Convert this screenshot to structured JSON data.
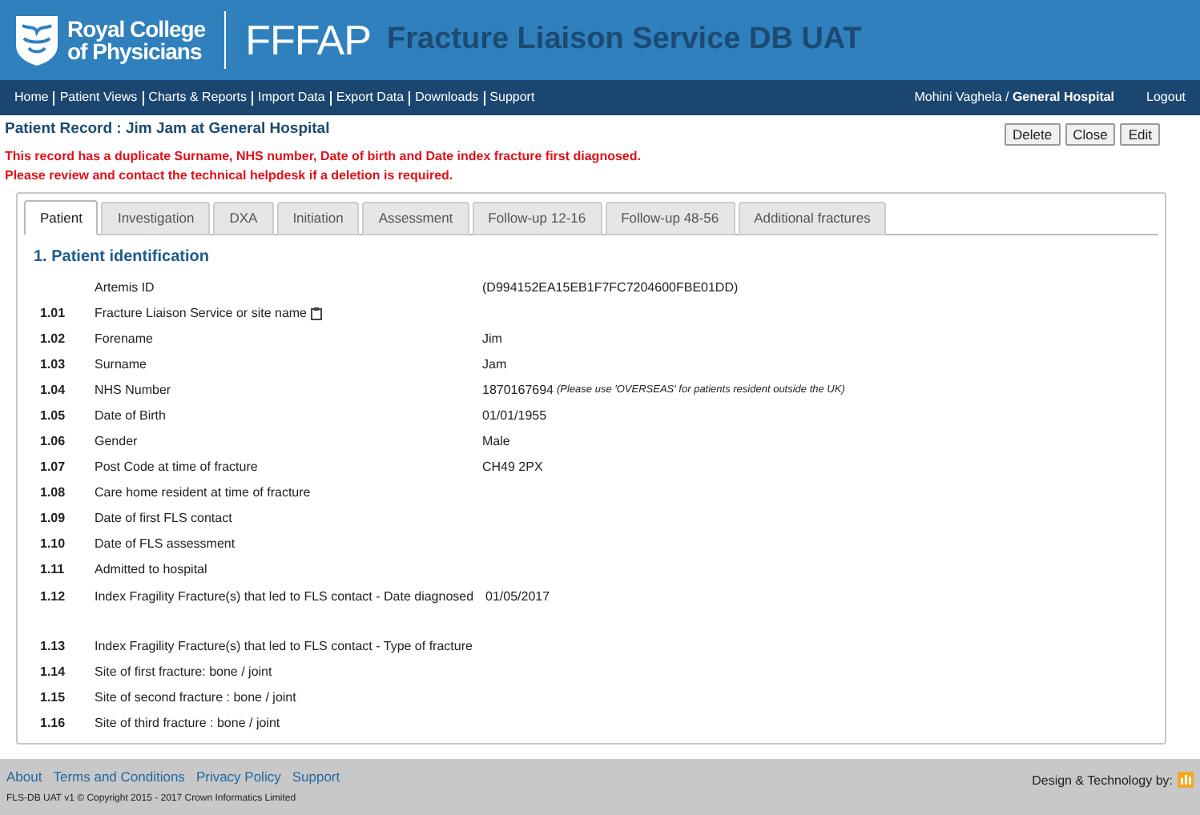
{
  "header": {
    "org_line_1": "Royal College",
    "org_line_2": "of Physicians",
    "program": "FFFAP",
    "app_title": "Fracture Liaison Service DB UAT"
  },
  "nav": {
    "items": [
      "Home",
      "Patient Views",
      "Charts & Reports",
      "Import Data",
      "Export Data",
      "Downloads",
      "Support"
    ],
    "user": "Mohini Vaghela / ",
    "hospital": "General Hospital",
    "logout": "Logout"
  },
  "page_title": "Patient Record : Jim Jam at General Hospital",
  "actions": [
    "Delete",
    "Close",
    "Edit"
  ],
  "warnings": [
    "This record has a duplicate Surname, NHS number, Date of birth and Date index fracture first diagnosed.",
    "Please review and contact the technical helpdesk if a deletion is required."
  ],
  "tabs": [
    {
      "label": "Patient",
      "selected": true
    },
    {
      "label": "Investigation",
      "selected": false
    },
    {
      "label": "DXA",
      "selected": false
    },
    {
      "label": "Initiation",
      "selected": false
    },
    {
      "label": "Assessment",
      "selected": false
    },
    {
      "label": "Follow-up 12-16",
      "selected": false
    },
    {
      "label": "Follow-up 48-56",
      "selected": false
    },
    {
      "label": "Additional fractures",
      "selected": false
    }
  ],
  "section_title": "1. Patient identification",
  "fields": [
    {
      "label": "Artemis ID",
      "value": "(D994152EA15EB1F7FC7204600FBE01DD)"
    },
    {
      "number": "1.01",
      "label": "Fracture Liaison Service or site name",
      "kind": "info"
    },
    {
      "number": "1.02",
      "label": "Forename",
      "value": "Jim"
    },
    {
      "number": "1.03",
      "label": "Surname",
      "value": "Jam"
    },
    {
      "number": "1.04",
      "label": "NHS Number",
      "value": "1870167694",
      "note": "(Please use 'OVERSEAS' for patients resident outside the UK)"
    },
    {
      "number": "1.05",
      "label": "Date of Birth",
      "value": "01/01/1955"
    },
    {
      "number": "1.06",
      "label": "Gender",
      "value": "Male"
    },
    {
      "number": "1.07",
      "label": "Post Code at time of fracture",
      "value": "CH49 2PX"
    },
    {
      "number": "1.08",
      "label": "Care home resident at time of fracture"
    },
    {
      "number": "1.09",
      "label": "Date of first FLS contact"
    },
    {
      "number": "1.10",
      "label": "Date of FLS assessment"
    },
    {
      "number": "1.11",
      "label": "Admitted to hospital"
    },
    {
      "number": "1.12",
      "label": "Index Fragility Fracture(s) that led to FLS contact - Date diagnosed",
      "value": "01/05/2017"
    },
    {
      "number": "1.13",
      "label": "Index Fragility Fracture(s) that led to FLS contact - Type of fracture"
    },
    {
      "number": "1.14",
      "label": "Site of first fracture: bone / joint"
    },
    {
      "number": "1.15",
      "label": "Site of second fracture : bone / joint"
    },
    {
      "number": "1.16",
      "label": "Site of third fracture : bone / joint"
    }
  ],
  "footer": {
    "links": [
      "About",
      "Terms and Conditions",
      "Privacy Policy",
      "Support"
    ],
    "copyright": "FLS-DB UAT v1 © Copyright 2015 - 2017 Crown Informatics Limited",
    "credit": "Design & Technology by:"
  }
}
